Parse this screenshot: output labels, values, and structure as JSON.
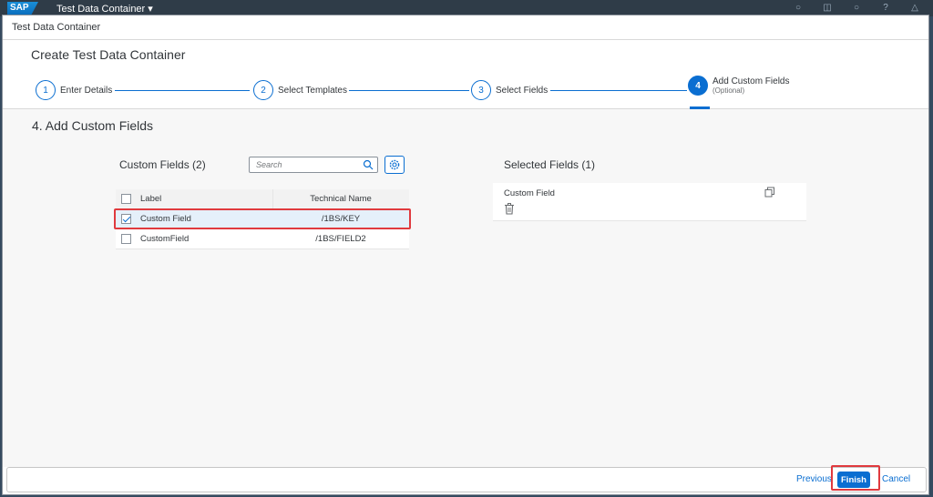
{
  "shell": {
    "logo": "SAP",
    "title": "Test Data Container ▾",
    "icons": [
      "search-icon",
      "copy-icon",
      "help-icon",
      "question-icon",
      "bell-icon"
    ]
  },
  "dialog": {
    "title": "Test Data Container",
    "page_title": "Create Test Data Container"
  },
  "wizard": {
    "steps": [
      {
        "number": "1",
        "label": "Enter Details"
      },
      {
        "number": "2",
        "label": "Select Templates"
      },
      {
        "number": "3",
        "label": "Select Fields"
      },
      {
        "number": "4",
        "label": "Add Custom Fields",
        "sub": "(Optional)"
      }
    ]
  },
  "section_title": "4. Add Custom Fields",
  "custom_fields": {
    "title": "Custom Fields (2)",
    "search_placeholder": "Search",
    "columns": {
      "label": "Label",
      "technical_name": "Technical Name"
    },
    "rows": [
      {
        "label": "Custom Field",
        "technical_name": "/1BS/KEY",
        "checked": true
      },
      {
        "label": "CustomField",
        "technical_name": "/1BS/FIELD2",
        "checked": false
      }
    ]
  },
  "selected_fields": {
    "title": "Selected Fields (1)",
    "items": [
      {
        "label": "Custom Field"
      }
    ]
  },
  "footer": {
    "previous": "Previous",
    "finish": "Finish",
    "cancel": "Cancel"
  },
  "colors": {
    "accent": "#0a6ed1",
    "highlight": "#e03a3e"
  }
}
